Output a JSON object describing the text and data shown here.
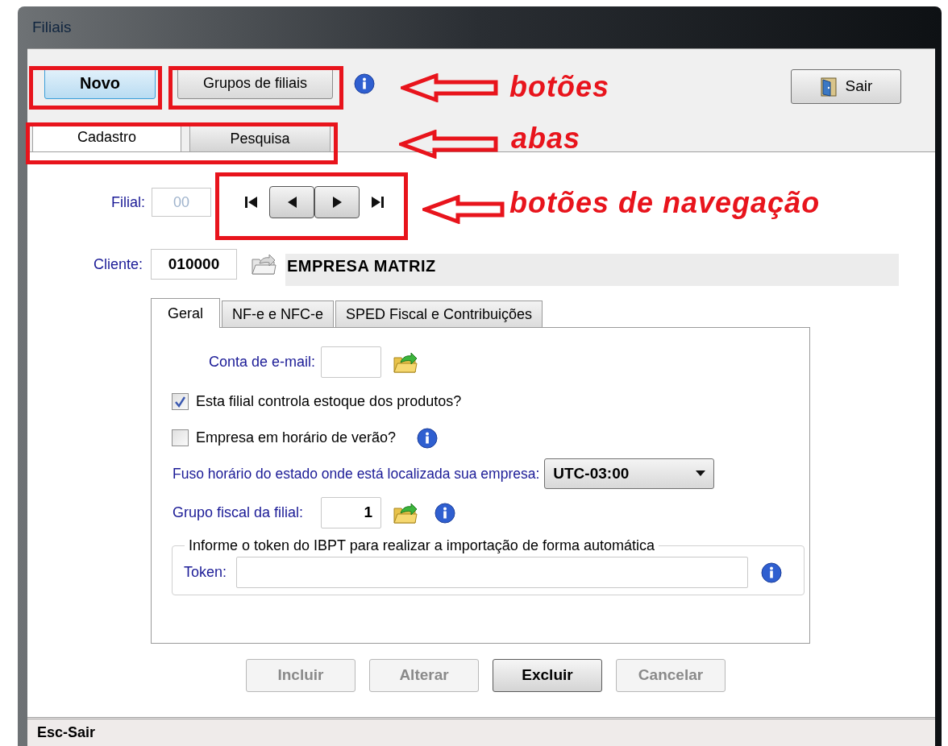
{
  "window": {
    "title": "Filiais"
  },
  "toolbar": {
    "buttons": [
      {
        "label": "Novo",
        "selected": true
      },
      {
        "label": "Grupos de filiais",
        "selected": false
      }
    ],
    "exit_button": {
      "label": "Sair"
    }
  },
  "tabs": [
    {
      "label": "Cadastro",
      "selected": true
    },
    {
      "label": "Pesquisa",
      "selected": false
    }
  ],
  "filial": {
    "label": "Filial:",
    "value": "00",
    "disabled": true
  },
  "navigation": [
    {
      "kind": "first",
      "raised": false
    },
    {
      "kind": "previous",
      "raised": true
    },
    {
      "kind": "next",
      "raised": true
    },
    {
      "kind": "last",
      "raised": false
    }
  ],
  "cliente": {
    "label": "Cliente:",
    "code": "010000",
    "name": "EMPRESA MATRIZ"
  },
  "inner_tabs": [
    {
      "label": "Geral",
      "selected": true
    },
    {
      "label": "NF-e e NFC-e",
      "selected": false
    },
    {
      "label": "SPED Fiscal e Contribuições",
      "selected": false
    }
  ],
  "geral": {
    "email": {
      "label": "Conta de e-mail:"
    },
    "checkboxes": [
      {
        "label": "Esta filial controla estoque dos produtos?",
        "checked": true,
        "info": false
      },
      {
        "label": "Empresa em horário de verão?",
        "checked": false,
        "info": true
      }
    ],
    "timezone": {
      "label": "Fuso horário do estado onde está localizada sua empresa:",
      "value": "UTC-03:00"
    },
    "fiscal_group": {
      "label": "Grupo fiscal da filial:",
      "value": "1"
    },
    "token_group": {
      "legend": "Informe o token do IBPT para realizar a importação de forma automática",
      "label": "Token:"
    }
  },
  "actions": [
    {
      "label": "Incluir",
      "disabled": true
    },
    {
      "label": "Alterar",
      "disabled": true
    },
    {
      "label": "Excluir",
      "disabled": false
    },
    {
      "label": "Cancelar",
      "disabled": true
    }
  ],
  "status_bar": "Esc-Sair",
  "annotations": [
    {
      "text": "botões"
    },
    {
      "text": "abas"
    },
    {
      "text": "botões de navegação"
    }
  ]
}
